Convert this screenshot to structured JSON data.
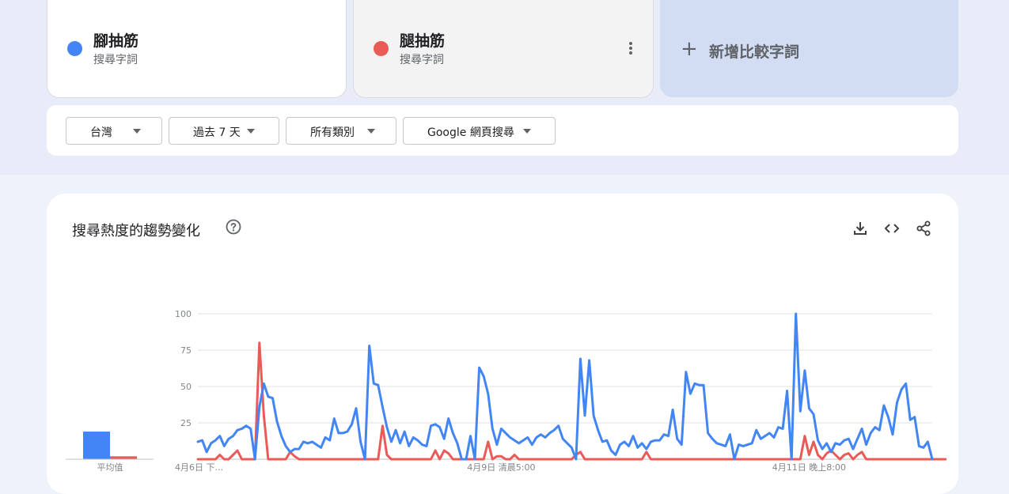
{
  "terms": [
    {
      "name": "腳抽筋",
      "subtitle": "搜尋字詞",
      "color": "#4285f4"
    },
    {
      "name": "腿抽筋",
      "subtitle": "搜尋字詞",
      "color": "#ea5a57"
    }
  ],
  "add_term": {
    "icon": "plus-icon",
    "label": "新增比較字詞"
  },
  "filters": [
    {
      "label": "台灣"
    },
    {
      "label": "過去 7 天"
    },
    {
      "label": "所有類別"
    },
    {
      "label": "Google 網頁搜尋"
    }
  ],
  "chart_section": {
    "title": "搜尋熱度的趨勢變化",
    "icons": [
      "help-icon",
      "download-icon",
      "embed-code-icon",
      "share-icon"
    ]
  },
  "chart_data": {
    "type": "line",
    "y_ticks": [
      "100",
      "75",
      "50",
      "25"
    ],
    "ylim": [
      0,
      100
    ],
    "grid": true,
    "x_tick_labels": [
      {
        "index": 0,
        "label": "4月6日 下..."
      },
      {
        "index": 69,
        "label": "4月9日 清晨5:00"
      },
      {
        "index": 139,
        "label": "4月11日 晚上8:00"
      }
    ],
    "series": [
      {
        "color": "#4285f4",
        "values": [
          12,
          13,
          5,
          11,
          13,
          16,
          9,
          14,
          16,
          20,
          21,
          23,
          21,
          0,
          36,
          52,
          43,
          42,
          26,
          16,
          9,
          5,
          7,
          7,
          12,
          11,
          12,
          10,
          8,
          15,
          13,
          28,
          18,
          18,
          19,
          24,
          35,
          12,
          0,
          78,
          52,
          51,
          36,
          22,
          12,
          20,
          11,
          19,
          9,
          15,
          13,
          10,
          9,
          23,
          24,
          22,
          14,
          28,
          18,
          11,
          0,
          0,
          16,
          0,
          63,
          57,
          45,
          21,
          10,
          21,
          18,
          15,
          13,
          11,
          13,
          15,
          10,
          15,
          17,
          15,
          18,
          20,
          23,
          14,
          11,
          8,
          0,
          69,
          30,
          68,
          30,
          20,
          12,
          13,
          6,
          3,
          10,
          12,
          9,
          16,
          8,
          11,
          7,
          12,
          13,
          13,
          17,
          16,
          34,
          14,
          10,
          60,
          45,
          52,
          51,
          51,
          18,
          14,
          11,
          10,
          9,
          17,
          0,
          10,
          9,
          10,
          11,
          20,
          14,
          16,
          18,
          15,
          22,
          21,
          47,
          0,
          100,
          33,
          61,
          35,
          31,
          13,
          7,
          11,
          5,
          11,
          10,
          13,
          14,
          7,
          14,
          21,
          10,
          18,
          22,
          20,
          37,
          29,
          17,
          39,
          48,
          52,
          27,
          29,
          9,
          8,
          12,
          0
        ]
      },
      {
        "color": "#ea5a57",
        "values": [
          0,
          0,
          0,
          0,
          0,
          3,
          0,
          0,
          3,
          6,
          0,
          0,
          0,
          0,
          80,
          30,
          0,
          0,
          0,
          0,
          0,
          5,
          2,
          0,
          0,
          0,
          0,
          0,
          0,
          0,
          0,
          0,
          0,
          0,
          0,
          0,
          0,
          0,
          0,
          0,
          0,
          0,
          23,
          3,
          0,
          0,
          0,
          0,
          0,
          0,
          0,
          0,
          0,
          0,
          6,
          0,
          6,
          4,
          0,
          0,
          0,
          0,
          0,
          0,
          0,
          0,
          12,
          0,
          2,
          2,
          0,
          0,
          3,
          0,
          0,
          0,
          0,
          0,
          0,
          0,
          0,
          0,
          0,
          0,
          0,
          0,
          3,
          5,
          0,
          0,
          0,
          0,
          0,
          0,
          0,
          0,
          0,
          0,
          0,
          0,
          0,
          0,
          5,
          0,
          0,
          0,
          0,
          0,
          0,
          0,
          0,
          0,
          0,
          0,
          0,
          0,
          0,
          0,
          0,
          0,
          0,
          0,
          0,
          0,
          0,
          0,
          0,
          0,
          0,
          0,
          0,
          0,
          0,
          0,
          0,
          0,
          0,
          0,
          16,
          3,
          12,
          3,
          0,
          4,
          6,
          3,
          0,
          3,
          4,
          0,
          3,
          5,
          0,
          0,
          0,
          0,
          0,
          0,
          0,
          0,
          0,
          0,
          0,
          0,
          0,
          0,
          0,
          0,
          0,
          0,
          0
        ]
      }
    ]
  },
  "average_chart": {
    "label": "平均值",
    "values": [
      {
        "color": "#4285f4",
        "value": 19
      },
      {
        "color": "#ea5a57",
        "value": 2
      }
    ],
    "max": 100
  }
}
